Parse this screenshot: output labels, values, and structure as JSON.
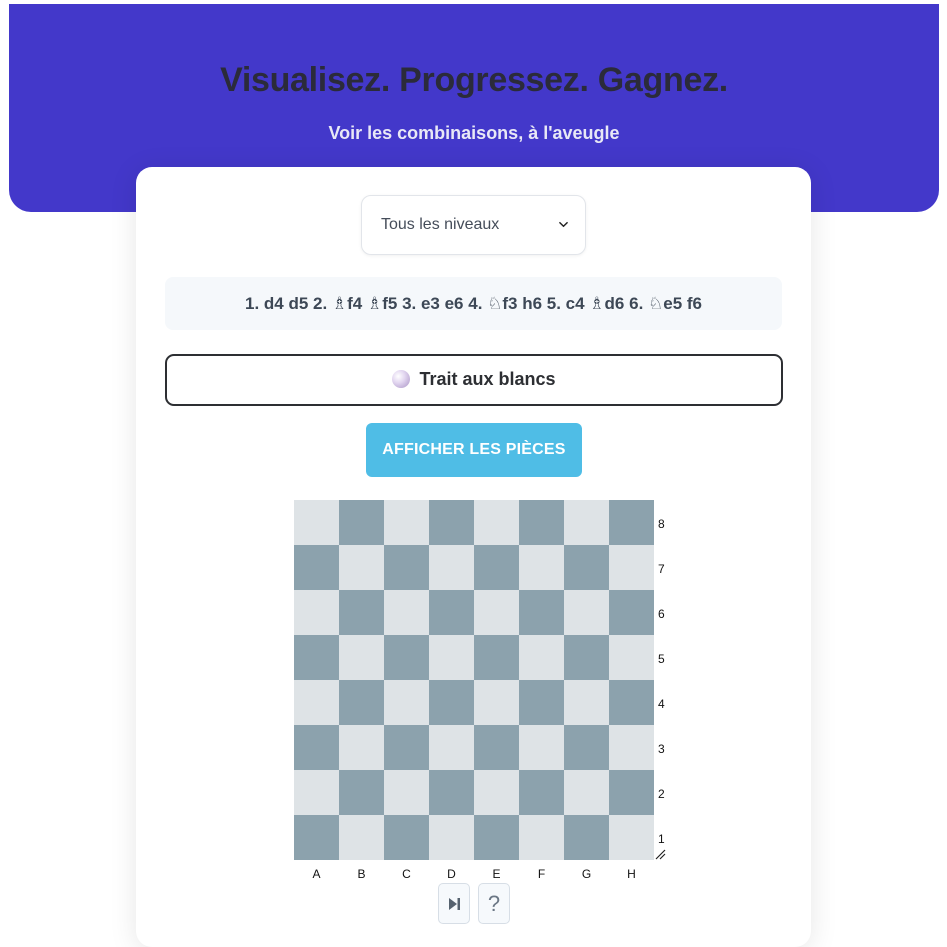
{
  "hero": {
    "title": "Visualisez. Progressez. Gagnez.",
    "subtitle": "Voir les combinaisons, à l'aveugle"
  },
  "level_select": {
    "selected": "Tous les niveaux"
  },
  "moves": {
    "text": "1. d4 d5 2. ♗f4 ♗f5 3. e3 e6 4. ♘f3 h6 5. c4 ♗d6 6. ♘e5 f6"
  },
  "turn": {
    "label": "Trait aux blancs"
  },
  "show_pieces_button": {
    "label": "AFFICHER LES PIÈCES"
  },
  "board": {
    "ranks": [
      "8",
      "7",
      "6",
      "5",
      "4",
      "3",
      "2",
      "1"
    ],
    "files": [
      "A",
      "B",
      "C",
      "D",
      "E",
      "F",
      "G",
      "H"
    ],
    "light_color": "#dee3e6",
    "dark_color": "#8ca2ad"
  },
  "controls": {
    "next_icon": "skip-forward-icon",
    "help_label": "?"
  },
  "colors": {
    "hero_bg": "#4338ca",
    "button_bg": "#4fbde6"
  }
}
